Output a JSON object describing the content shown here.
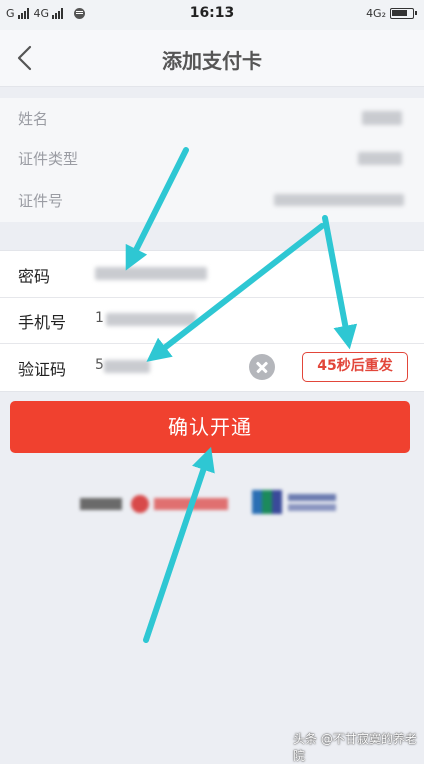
{
  "status_bar": {
    "carrier_1": "G",
    "carrier_2": "4G",
    "time": "16:13",
    "network_right": "4G₂"
  },
  "nav": {
    "title": "添加支付卡"
  },
  "info": {
    "name_label": "姓名",
    "id_type_label": "证件类型",
    "id_no_label": "证件号"
  },
  "form": {
    "password_label": "密码",
    "phone_label": "手机号",
    "phone_value_prefix": "1",
    "code_label": "验证码",
    "code_value_prefix": "5",
    "resend_label": "45秒后重发"
  },
  "confirm_label": "确认开通",
  "watermark": "头条 @不甘寂寞的养老院",
  "colors": {
    "accent": "#f0412f",
    "arrow": "#2ec7d3",
    "background": "#eceef3"
  }
}
